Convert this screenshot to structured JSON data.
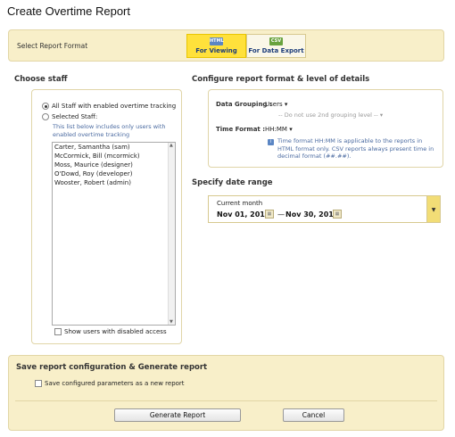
{
  "page_title": "Create Overtime Report",
  "format_bar": {
    "label": "Select Report Format",
    "formats": [
      {
        "icon": "HTML",
        "label": "For Viewing",
        "active": true
      },
      {
        "icon": "CSV",
        "label": "For Data Export",
        "active": false
      }
    ]
  },
  "staff": {
    "heading": "Choose staff",
    "option_all": "All Staff with enabled overtime tracking",
    "option_selected": "Selected Staff:",
    "note": "This list below includes only users with enabled overtime tracking",
    "list": [
      "Carter, Samantha (sam)",
      "McCormick, Bill (mcormick)",
      "Moss, Maurice (designer)",
      "O'Dowd, Roy (developer)",
      "Wooster, Robert (admin)"
    ],
    "show_disabled": "Show users with disabled access"
  },
  "config": {
    "heading": "Configure report format & level of details",
    "grouping_label": "Data Grouping :",
    "grouping_value": "Users",
    "second_grouping": "-- Do not use 2nd grouping level --",
    "time_format_label": "Time Format :",
    "time_format_value": "HH:MM",
    "time_note": "Time format HH:MM is applicable to the reports in HTML format only. CSV reports always present time in decimal format (##.##)."
  },
  "date_range": {
    "heading": "Specify date range",
    "caption": "Current month",
    "start": "Nov 01, 2011",
    "separator": "—",
    "end": "Nov 30, 2011"
  },
  "save": {
    "title": "Save report configuration & Generate report",
    "save_checkbox": "Save configured parameters as a new report",
    "generate_button": "Generate Report",
    "cancel_button": "Cancel"
  }
}
